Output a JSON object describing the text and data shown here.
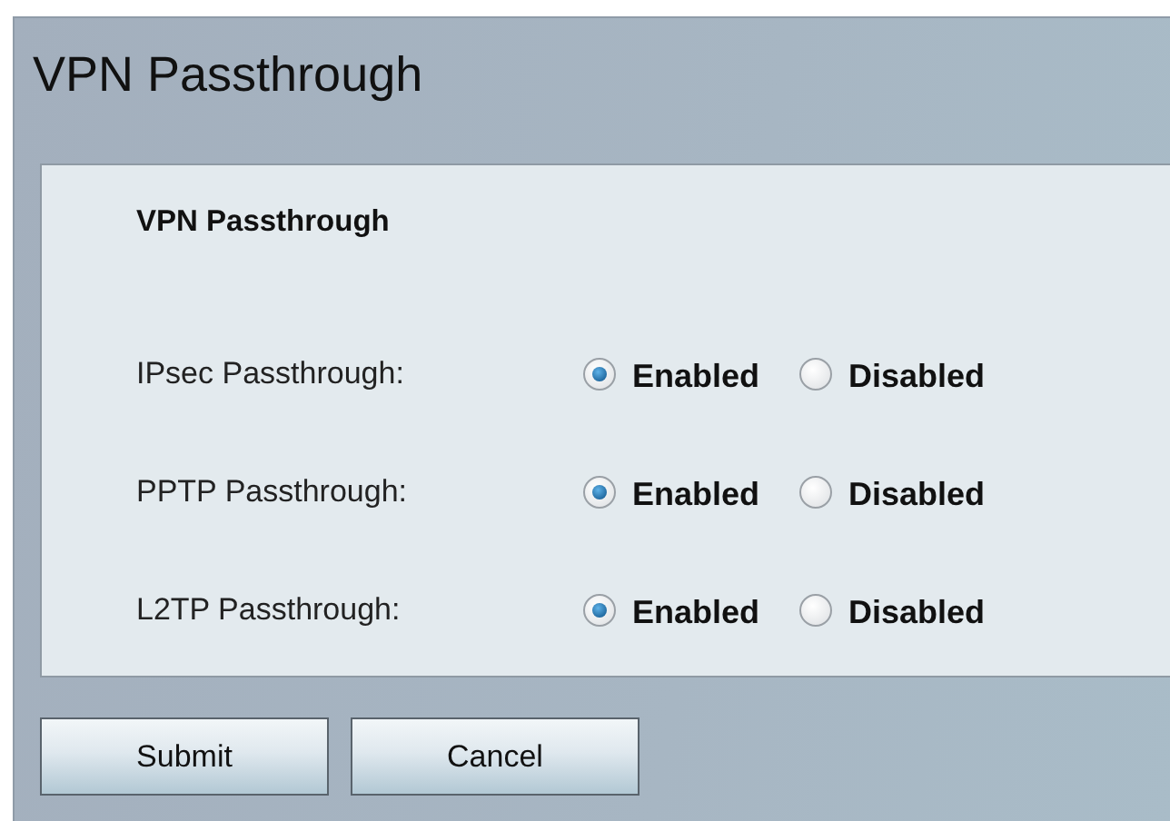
{
  "page": {
    "title": "VPN Passthrough"
  },
  "section": {
    "heading": "VPN Passthrough",
    "rows": [
      {
        "label": "IPsec Passthrough:",
        "options": [
          {
            "label": "Enabled",
            "selected": true
          },
          {
            "label": "Disabled",
            "selected": false
          }
        ]
      },
      {
        "label": "PPTP Passthrough:",
        "options": [
          {
            "label": "Enabled",
            "selected": true
          },
          {
            "label": "Disabled",
            "selected": false
          }
        ]
      },
      {
        "label": "L2TP Passthrough:",
        "options": [
          {
            "label": "Enabled",
            "selected": true
          },
          {
            "label": "Disabled",
            "selected": false
          }
        ]
      }
    ]
  },
  "buttons": [
    "Submit",
    "Cancel"
  ]
}
